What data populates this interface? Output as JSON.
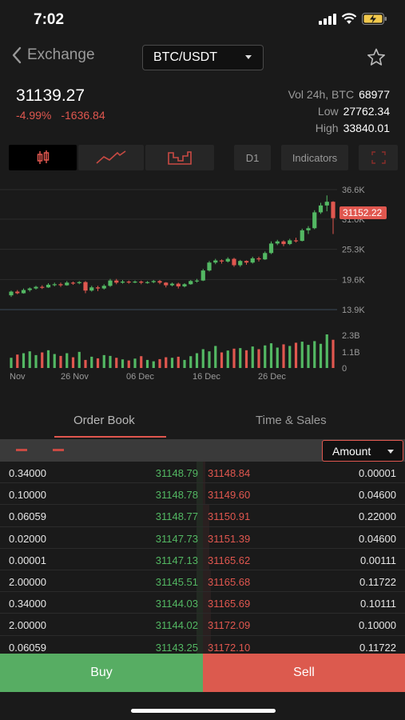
{
  "status_bar": {
    "time": "7:02",
    "icons": [
      "signal-icon",
      "wifi-icon",
      "battery-charging-icon"
    ]
  },
  "nav": {
    "back_label": "Exchange",
    "pair": "BTC/USDT",
    "icons": [
      "chevron-left-icon",
      "star-icon"
    ]
  },
  "price": {
    "last": "31139.27",
    "change_pct": "-4.99%",
    "change_abs": "-1636.84"
  },
  "stats": {
    "vol_label": "Vol 24h, BTC",
    "vol_value": "68977",
    "low_label": "Low",
    "low_value": "27762.34",
    "high_label": "High",
    "high_value": "33840.01"
  },
  "toolbar": {
    "timeframe": "D1",
    "indicators": "Indicators",
    "icons": [
      "candlestick-icon",
      "line-chart-icon",
      "area-chart-icon",
      "fullscreen-icon"
    ]
  },
  "chart": {
    "price_labels": [
      "36.6K",
      "31.0K",
      "25.3K",
      "19.6K",
      "13.9K"
    ],
    "current_price_tag": "31152.22",
    "volume_labels": [
      "2.3B",
      "1.1B",
      "0"
    ],
    "x_labels": [
      "Nov",
      "26 Nov",
      "06 Dec",
      "16 Dec",
      "26 Dec"
    ]
  },
  "chart_data": {
    "type": "candlestick",
    "price_ticks": [
      36600,
      31000,
      25300,
      19600,
      13900
    ],
    "price_ylim": [
      13900,
      36600
    ],
    "volume_ticks": [
      2300000000,
      1100000000,
      0
    ],
    "x_ticks": [
      "Nov",
      "26 Nov",
      "06 Dec",
      "16 Dec",
      "26 Dec"
    ],
    "candles": [
      [
        16.6,
        17.3,
        16.3,
        17.5
      ],
      [
        17.3,
        17.0,
        16.8,
        17.6
      ],
      [
        17.0,
        17.6,
        16.9,
        17.9
      ],
      [
        17.6,
        17.9,
        17.3,
        18.1
      ],
      [
        17.9,
        18.2,
        17.7,
        18.4
      ],
      [
        18.2,
        18.1,
        17.8,
        18.5
      ],
      [
        18.1,
        18.6,
        18.0,
        18.9
      ],
      [
        18.6,
        18.7,
        18.3,
        19.0
      ],
      [
        18.7,
        18.5,
        18.2,
        19.0
      ],
      [
        18.5,
        19.0,
        18.4,
        19.3
      ],
      [
        19.0,
        18.9,
        18.6,
        19.2
      ],
      [
        18.9,
        19.1,
        18.7,
        19.3
      ],
      [
        19.1,
        17.5,
        17.0,
        19.3
      ],
      [
        17.5,
        18.1,
        17.3,
        18.4
      ],
      [
        18.1,
        17.9,
        17.4,
        18.4
      ],
      [
        17.9,
        18.4,
        17.7,
        18.7
      ],
      [
        18.4,
        19.4,
        18.2,
        19.7
      ],
      [
        19.4,
        19.0,
        18.7,
        19.7
      ],
      [
        19.0,
        19.2,
        18.8,
        19.5
      ],
      [
        19.2,
        19.1,
        18.8,
        19.4
      ],
      [
        19.1,
        19.2,
        18.9,
        19.4
      ],
      [
        19.2,
        19.0,
        18.7,
        19.4
      ],
      [
        19.0,
        19.1,
        18.8,
        19.3
      ],
      [
        19.1,
        19.3,
        18.9,
        19.5
      ],
      [
        19.3,
        19.0,
        18.7,
        19.5
      ],
      [
        19.0,
        18.5,
        18.1,
        19.1
      ],
      [
        18.5,
        18.8,
        18.3,
        19.0
      ],
      [
        18.8,
        18.3,
        17.9,
        19.0
      ],
      [
        18.3,
        18.7,
        18.1,
        18.9
      ],
      [
        18.7,
        19.3,
        18.6,
        19.5
      ],
      [
        19.3,
        19.4,
        19.0,
        19.7
      ],
      [
        19.4,
        21.3,
        19.3,
        21.6
      ],
      [
        21.3,
        22.8,
        21.1,
        23.1
      ],
      [
        22.8,
        23.2,
        22.5,
        23.5
      ],
      [
        23.2,
        23.0,
        22.6,
        23.4
      ],
      [
        23.0,
        23.5,
        22.8,
        23.8
      ],
      [
        23.5,
        22.3,
        22.0,
        23.7
      ],
      [
        22.3,
        23.1,
        22.0,
        23.3
      ],
      [
        23.1,
        22.8,
        22.4,
        23.2
      ],
      [
        22.8,
        23.6,
        22.6,
        23.9
      ],
      [
        23.6,
        23.4,
        23.0,
        23.9
      ],
      [
        23.4,
        24.6,
        23.3,
        24.9
      ],
      [
        24.6,
        26.4,
        24.4,
        26.8
      ],
      [
        26.4,
        26.8,
        26.1,
        27.1
      ],
      [
        26.8,
        26.3,
        25.9,
        27.0
      ],
      [
        26.3,
        27.0,
        26.1,
        27.3
      ],
      [
        27.0,
        26.9,
        26.6,
        27.5
      ],
      [
        26.9,
        28.9,
        26.8,
        29.2
      ],
      [
        28.9,
        29.3,
        28.2,
        29.7
      ],
      [
        29.3,
        32.3,
        29.1,
        32.7
      ],
      [
        32.3,
        33.6,
        32.0,
        34.1
      ],
      [
        33.6,
        34.3,
        32.5,
        35.5
      ],
      [
        34.3,
        31.2,
        28.2,
        34.4
      ]
    ],
    "volumes": [
      0.38,
      0.5,
      0.55,
      0.62,
      0.48,
      0.58,
      0.66,
      0.52,
      0.45,
      0.55,
      0.4,
      0.6,
      0.3,
      0.42,
      0.36,
      0.48,
      0.45,
      0.38,
      0.32,
      0.28,
      0.35,
      0.44,
      0.3,
      0.25,
      0.33,
      0.4,
      0.38,
      0.42,
      0.3,
      0.44,
      0.55,
      0.7,
      0.62,
      0.82,
      0.58,
      0.65,
      0.72,
      0.74,
      0.66,
      0.8,
      0.7,
      0.84,
      0.92,
      0.76,
      0.88,
      0.82,
      0.94,
      0.98,
      0.86,
      1.0,
      0.9,
      1.25,
      1.05
    ]
  },
  "tabs": [
    {
      "label": "Order Book"
    },
    {
      "label": "Time & Sales"
    }
  ],
  "order_book": {
    "amount_label": "Amount",
    "rows": [
      {
        "bid_qty": "0.34000",
        "bid_price": "31148.79",
        "ask_price": "31148.84",
        "ask_qty": "0.00001",
        "bid_depth": 0.03,
        "ask_depth": 0.01
      },
      {
        "bid_qty": "0.10000",
        "bid_price": "31148.78",
        "ask_price": "31149.60",
        "ask_qty": "0.04600",
        "bid_depth": 0.03,
        "ask_depth": 0.01
      },
      {
        "bid_qty": "0.06059",
        "bid_price": "31148.77",
        "ask_price": "31150.91",
        "ask_qty": "0.22000",
        "bid_depth": 0.03,
        "ask_depth": 0.03
      },
      {
        "bid_qty": "0.02000",
        "bid_price": "31147.73",
        "ask_price": "31151.39",
        "ask_qty": "0.04600",
        "bid_depth": 0.03,
        "ask_depth": 0.03
      },
      {
        "bid_qty": "0.00001",
        "bid_price": "31147.13",
        "ask_price": "31165.62",
        "ask_qty": "0.00111",
        "bid_depth": 0.03,
        "ask_depth": 0.03
      },
      {
        "bid_qty": "2.00000",
        "bid_price": "31145.51",
        "ask_price": "31165.68",
        "ask_qty": "0.11722",
        "bid_depth": 0.03,
        "ask_depth": 0.04
      },
      {
        "bid_qty": "0.34000",
        "bid_price": "31144.03",
        "ask_price": "31165.69",
        "ask_qty": "0.10111",
        "bid_depth": 0.03,
        "ask_depth": 0.04
      },
      {
        "bid_qty": "2.00000",
        "bid_price": "31144.02",
        "ask_price": "31172.09",
        "ask_qty": "0.10000",
        "bid_depth": 0.03,
        "ask_depth": 0.04
      },
      {
        "bid_qty": "0.06059",
        "bid_price": "31143.25",
        "ask_price": "31172.10",
        "ask_qty": "0.11722",
        "bid_depth": 0.03,
        "ask_depth": 0.04
      }
    ]
  },
  "actions": {
    "buy": "Buy",
    "sell": "Sell"
  },
  "colors": {
    "up": "#53b863",
    "down": "#e0574f",
    "buy_bg": "#57ad63",
    "sell_bg": "#dc5a4e"
  }
}
